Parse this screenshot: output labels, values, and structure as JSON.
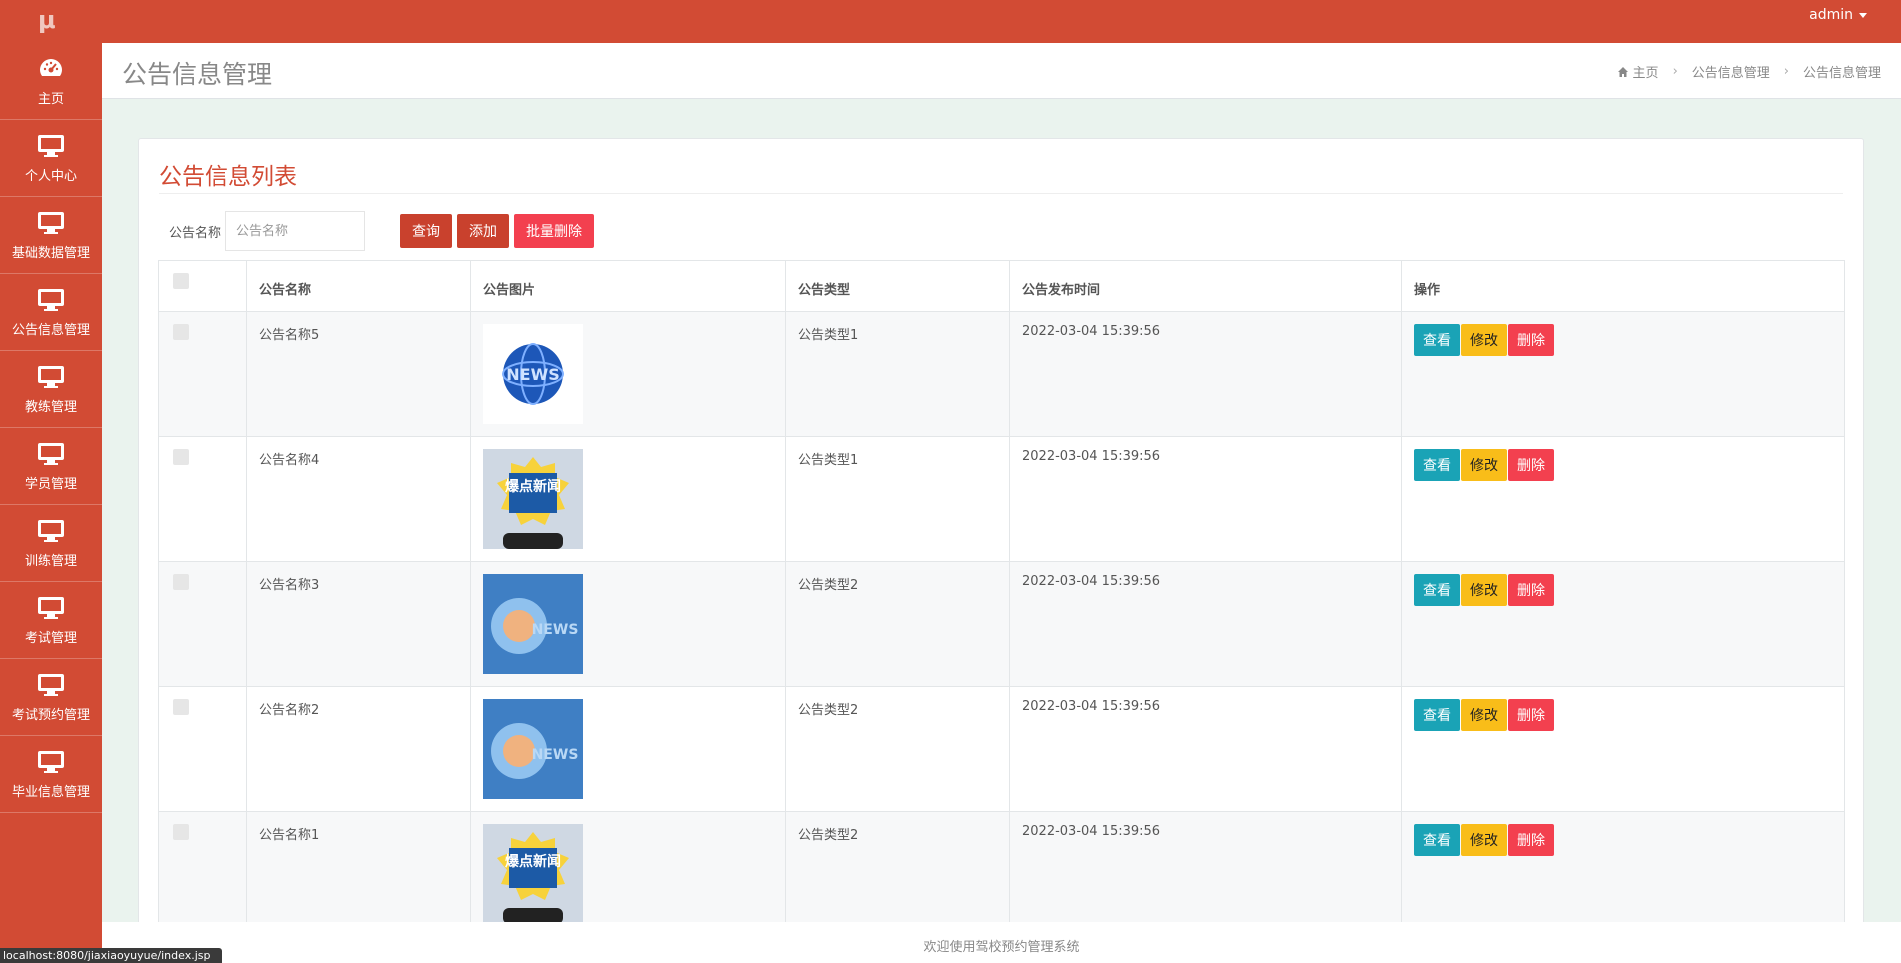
{
  "topbar": {
    "logo": "μ",
    "user": "admin"
  },
  "sidebar": {
    "items": [
      {
        "label": "主页",
        "icon": "dashboard-icon"
      },
      {
        "label": "个人中心",
        "icon": "monitor-icon"
      },
      {
        "label": "基础数据管理",
        "icon": "monitor-icon"
      },
      {
        "label": "公告信息管理",
        "icon": "monitor-icon"
      },
      {
        "label": "教练管理",
        "icon": "monitor-icon"
      },
      {
        "label": "学员管理",
        "icon": "monitor-icon"
      },
      {
        "label": "训练管理",
        "icon": "monitor-icon"
      },
      {
        "label": "考试管理",
        "icon": "monitor-icon"
      },
      {
        "label": "考试预约管理",
        "icon": "monitor-icon"
      },
      {
        "label": "毕业信息管理",
        "icon": "monitor-icon"
      }
    ]
  },
  "header": {
    "title": "公告信息管理",
    "breadcrumb": [
      "主页",
      "公告信息管理",
      "公告信息管理"
    ]
  },
  "card": {
    "title": "公告信息列表",
    "search": {
      "label": "公告名称",
      "placeholder": "公告名称",
      "value": ""
    },
    "buttons": {
      "query": "查询",
      "add": "添加",
      "bulk_delete": "批量删除"
    }
  },
  "table": {
    "headers": [
      "公告名称",
      "公告图片",
      "公告类型",
      "公告发布时间",
      "操作"
    ],
    "rows": [
      {
        "name": "公告名称5",
        "image": "news-globe",
        "type": "公告类型1",
        "time": "2022-03-04 15:39:56"
      },
      {
        "name": "公告名称4",
        "image": "breaking-news",
        "type": "公告类型1",
        "time": "2022-03-04 15:39:56"
      },
      {
        "name": "公告名称3",
        "image": "news-blue",
        "type": "公告类型2",
        "time": "2022-03-04 15:39:56"
      },
      {
        "name": "公告名称2",
        "image": "news-blue",
        "type": "公告类型2",
        "time": "2022-03-04 15:39:56"
      },
      {
        "name": "公告名称1",
        "image": "breaking-news",
        "type": "公告类型2",
        "time": "2022-03-04 15:39:56"
      }
    ],
    "ops": {
      "view": "查看",
      "edit": "修改",
      "delete": "删除"
    },
    "image_texts": {
      "globe": "NEWS",
      "breaking": "爆点新闻",
      "blue": "NEWS"
    }
  },
  "footer": {
    "text": "欢迎使用驾校预约管理系统"
  },
  "statusbar": {
    "url": "localhost:8080/jiaxiaoyuyue/index.jsp"
  },
  "colors": {
    "primary": "#d24b34",
    "view": "#1aa3b6",
    "edit": "#f9bd19",
    "delete": "#f3404f"
  }
}
